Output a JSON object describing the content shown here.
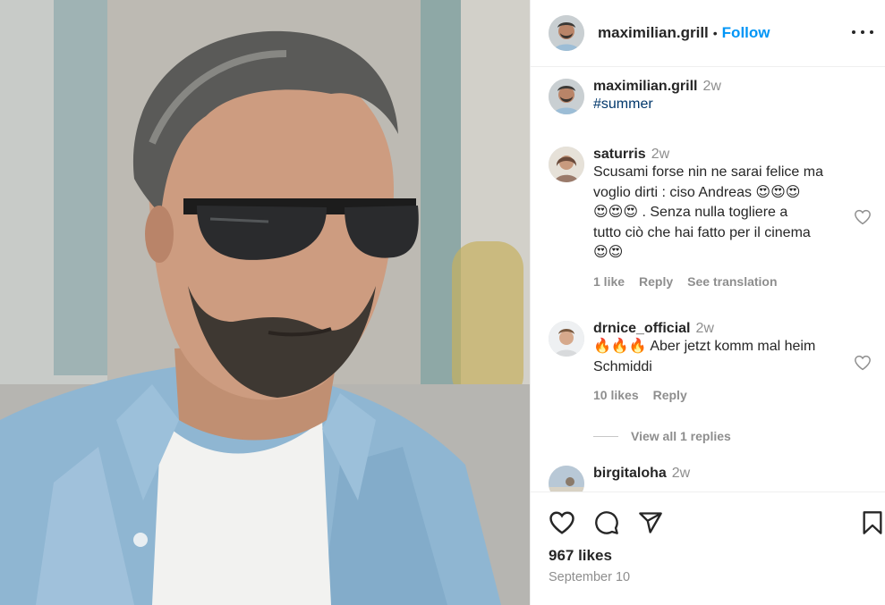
{
  "post": {
    "author": "maximilian.grill",
    "follow_label": "Follow",
    "separator": "•",
    "caption_time": "2w",
    "caption": "#summer",
    "likes": "967 likes",
    "date": "September 10"
  },
  "comments": [
    {
      "user": "saturris",
      "time": "2w",
      "text_lines": [
        "Scusami forse nin ne sarai felice ma",
        "voglio dirti : ciso Andreas 😍😍😍",
        "😍😍😍 . Senza nulla togliere a",
        "tutto ciò che hai fatto per il cinema",
        "😍😍"
      ],
      "likes": "1 like",
      "reply": "Reply",
      "translate": "See translation"
    },
    {
      "user": "drnice_official",
      "time": "2w",
      "text_lines": [
        "🔥🔥🔥 Aber jetzt komm mal heim",
        "Schmiddi"
      ],
      "likes": "10 likes",
      "reply": "Reply",
      "view_replies": "View all 1 replies"
    },
    {
      "user": "birgitaloha",
      "time": "2w"
    }
  ],
  "icons": {
    "more": "more-options-icon",
    "like": "heart-icon",
    "comment": "comment-icon",
    "share": "paper-plane-icon",
    "save": "bookmark-icon"
  },
  "colors": {
    "accent": "#0095f6",
    "text": "#262626",
    "muted": "#8e8e8e",
    "hashtag": "#00376b"
  }
}
